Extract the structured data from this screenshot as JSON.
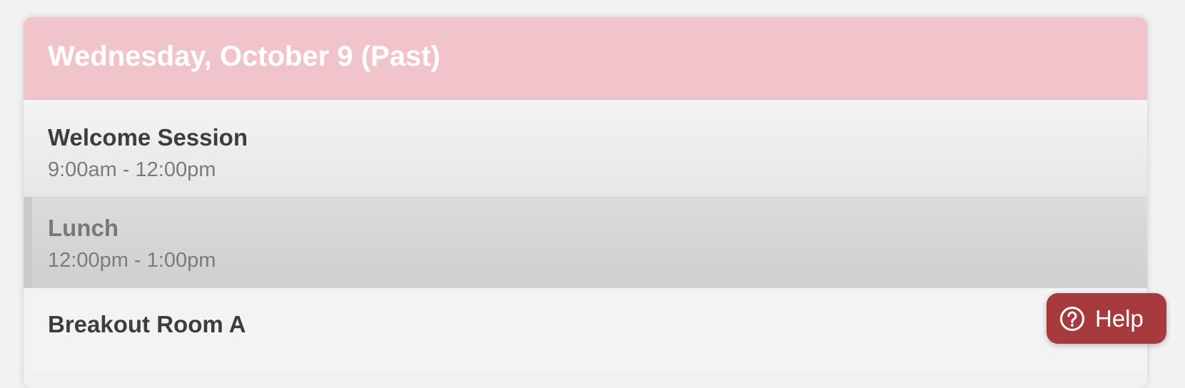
{
  "day": {
    "title": "Wednesday, October 9 (Past)"
  },
  "sessions": [
    {
      "title": "Welcome Session",
      "time": "9:00am - 12:00pm"
    },
    {
      "title": "Lunch",
      "time": "12:00pm - 1:00pm"
    },
    {
      "title": "Breakout Room A"
    }
  ],
  "help": {
    "label": "Help",
    "icon": "question-circle-icon"
  },
  "colors": {
    "header_bg": "#f0c4ca",
    "help_bg": "#a63a3d"
  }
}
